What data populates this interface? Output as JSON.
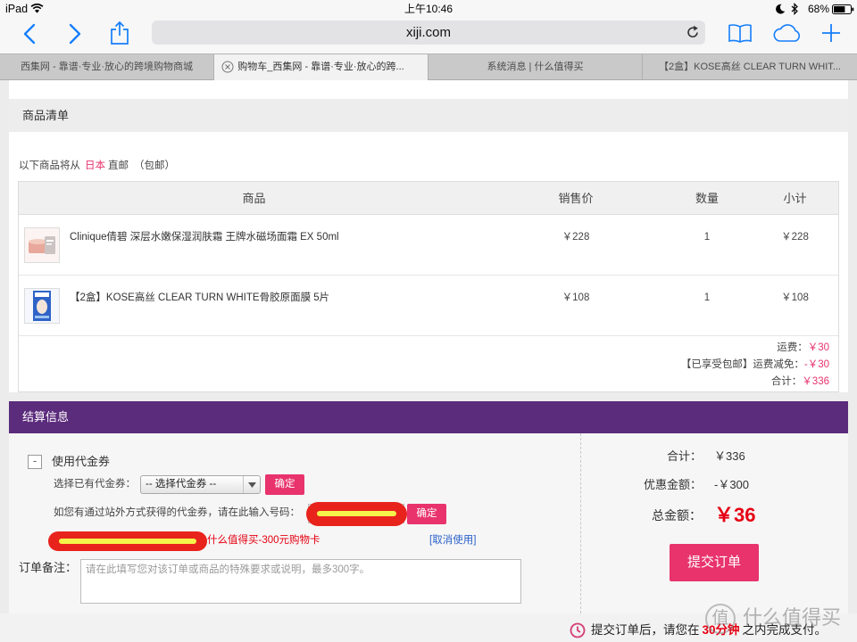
{
  "status_bar": {
    "device": "iPad",
    "time": "上午10:46",
    "battery_percent": "68%",
    "icons": [
      "wifi-icon",
      "moon-icon",
      "bluetooth-icon",
      "battery-icon"
    ]
  },
  "browser": {
    "url": "xiji.com",
    "toolbar_icons": [
      "back-icon",
      "forward-icon",
      "share-icon",
      "reload-icon",
      "bookmarks-icon",
      "cloud-tabs-icon",
      "new-tab-icon"
    ],
    "active_tab_index": 1,
    "tabs": [
      {
        "title": "西集网 - 靠谱·专业·放心的跨境购物商城"
      },
      {
        "title": "购物车_西集网 - 靠谱·专业·放心的跨..."
      },
      {
        "title": "系统消息 | 什么值得买"
      },
      {
        "title": "【2盒】KOSE高丝 CLEAR TURN WHIT..."
      }
    ]
  },
  "cart": {
    "section_title": "商品清单",
    "shipping_note": {
      "prefix": "以下商品将从",
      "origin": "日本",
      "method": "直邮",
      "free_shipping": "（包邮）"
    },
    "columns": [
      "商品",
      "销售价",
      "数量",
      "小计"
    ],
    "items": [
      {
        "name": "Clinique倩碧 深层水嫩保湿润肤霜 王牌水磁场面霜 EX 50ml",
        "price": "￥228",
        "qty": "1",
        "subtotal": "￥228"
      },
      {
        "name": "【2盒】KOSE高丝 CLEAR TURN WHITE骨胶原面膜 5片",
        "price": "￥108",
        "qty": "1",
        "subtotal": "￥108"
      }
    ],
    "summary": [
      {
        "label": "运费：",
        "value": "￥30"
      },
      {
        "label": "【已享受包邮】运费减免：",
        "value": "-￥30"
      },
      {
        "label": "合计：",
        "value": "￥336"
      }
    ]
  },
  "checkout": {
    "section_title": "结算信息",
    "voucher": {
      "toggle_symbol": "-",
      "label": "使用代金券",
      "select_label": "选择已有代金券：",
      "select_value": "-- 选择代金券 --",
      "confirm_label": "确定",
      "code_label": "如您有通过站外方式获得的代金券，请在此输入号码：",
      "code_confirm_label": "确定",
      "applied_name": "什么值得买-300元购物卡",
      "cancel_label": "[取消使用]"
    },
    "remark": {
      "label": "订单备注：",
      "placeholder": "请在此填写您对该订单或商品的特殊要求或说明，最多300字。"
    },
    "totals": [
      {
        "label": "合计：",
        "value": "￥336"
      },
      {
        "label": "优惠金额：",
        "value": "-￥300"
      },
      {
        "label": "总金额：",
        "value": "￥36"
      }
    ],
    "submit_label": "提交订单"
  },
  "footer": {
    "prefix": "提交订单后，请您在",
    "deadline": "30分钟",
    "suffix": "之内完成支付。"
  },
  "watermark": {
    "glyph": "值",
    "text": "什么值得买"
  },
  "colors": {
    "accent": "#e8336d",
    "purple": "#5b2b7c",
    "price": "#e60012",
    "link": "#2a62c9",
    "ios_blue": "#157efb"
  }
}
